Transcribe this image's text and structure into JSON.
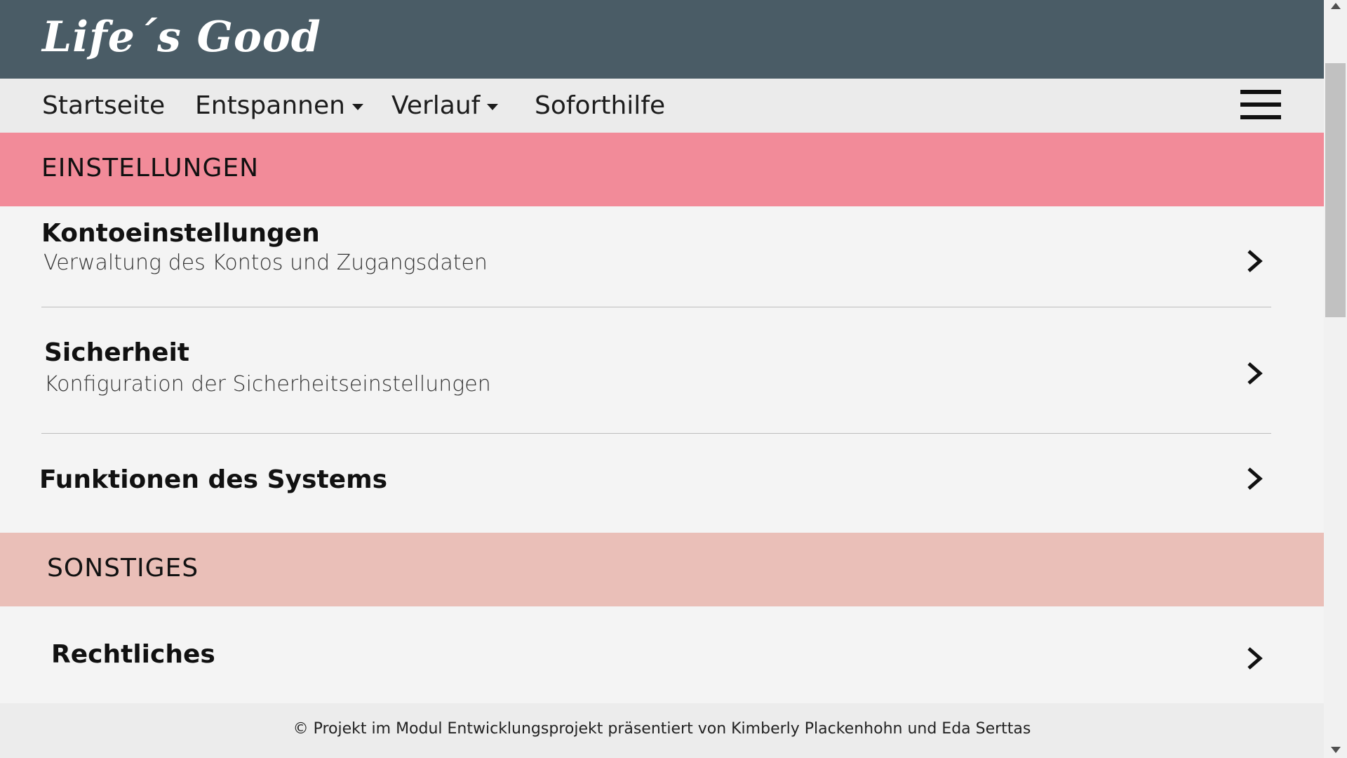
{
  "header": {
    "logo": "Life´s Good",
    "background": "#4a5c66"
  },
  "nav": {
    "items": [
      {
        "label": "Startseite",
        "has_dropdown": false
      },
      {
        "label": "Entspannen",
        "has_dropdown": true
      },
      {
        "label": "Verlauf",
        "has_dropdown": true
      },
      {
        "label": "Soforthilfe",
        "has_dropdown": false
      }
    ],
    "menu_icon": "hamburger-menu-icon"
  },
  "sections": [
    {
      "label": "EINSTELLUNGEN",
      "color": "#f28b99",
      "items": [
        {
          "title": "Kontoeinstellungen",
          "subtitle": "Verwaltung des Kontos und Zugangsdaten",
          "icon": "chevron-right-icon"
        },
        {
          "title": "Sicherheit",
          "subtitle": "Konfiguration der Sicherheitseinstellungen",
          "icon": "chevron-right-icon"
        },
        {
          "title": "Funktionen des Systems",
          "icon": "chevron-right-icon"
        }
      ]
    },
    {
      "label": "SONSTIGES",
      "color": "#eabfb8",
      "items": [
        {
          "title": "Rechtliches",
          "icon": "chevron-right-icon"
        }
      ]
    }
  ],
  "footer": {
    "text": "© Projekt im Modul Entwicklungsprojekt präsentiert von Kimberly Plackenhohn und Eda Serttas"
  }
}
